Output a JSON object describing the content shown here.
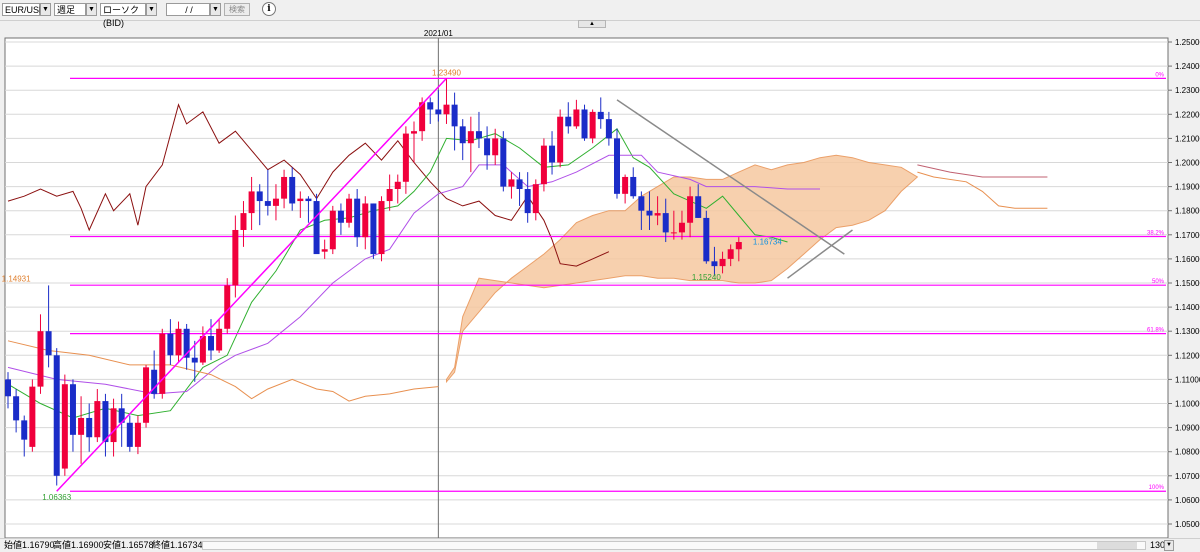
{
  "toolbar": {
    "symbol": "EUR/USD",
    "period": "週足",
    "chart_type": "ローソク(BID)",
    "date_value": " /  / ",
    "search_label": "検索",
    "info_label": "i",
    "arrow": "▼"
  },
  "status": {
    "open": "始値1.16790",
    "high": "高値1.16900",
    "low": "安値1.16578",
    "close": "終値1.16734",
    "zoom": "130"
  },
  "colors": {
    "up": "#f0003c",
    "down": "#1a2cc8",
    "magenta": "#ff00ff",
    "cloud": "#f6c8a0",
    "lagging": "#8b1010",
    "tenkan": "#30b030",
    "kijun": "#b050e8",
    "trend": "#8a8a8a"
  },
  "chart_data": {
    "type": "candlestick",
    "xlabel": "",
    "ylabel": "",
    "ylim": [
      1.05,
      1.25
    ],
    "y_ticks": [
      "1.25000",
      "1.24000",
      "1.23000",
      "1.22000",
      "1.21000",
      "1.20000",
      "1.19000",
      "1.18000",
      "1.17000",
      "1.16000",
      "1.15000",
      "1.14000",
      "1.13000",
      "1.12000",
      "1.11000",
      "1.10000",
      "1.09000",
      "1.08000",
      "1.07000",
      "1.06000",
      "1.05000"
    ],
    "x_label": "2021/01",
    "x_label_index": 53,
    "candles": [
      [
        1.11,
        1.113,
        1.098,
        1.103
      ],
      [
        1.103,
        1.106,
        1.088,
        1.093
      ],
      [
        1.093,
        1.095,
        1.078,
        1.085
      ],
      [
        1.082,
        1.11,
        1.08,
        1.107
      ],
      [
        1.107,
        1.137,
        1.104,
        1.13
      ],
      [
        1.13,
        1.149,
        1.115,
        1.12
      ],
      [
        1.12,
        1.123,
        1.066,
        1.07
      ],
      [
        1.073,
        1.112,
        1.07,
        1.108
      ],
      [
        1.108,
        1.11,
        1.08,
        1.087
      ],
      [
        1.087,
        1.103,
        1.075,
        1.094
      ],
      [
        1.094,
        1.1,
        1.08,
        1.086
      ],
      [
        1.086,
        1.106,
        1.084,
        1.101
      ],
      [
        1.101,
        1.104,
        1.078,
        1.084
      ],
      [
        1.084,
        1.102,
        1.078,
        1.098
      ],
      [
        1.098,
        1.104,
        1.082,
        1.092
      ],
      [
        1.092,
        1.095,
        1.08,
        1.082
      ],
      [
        1.082,
        1.095,
        1.079,
        1.092
      ],
      [
        1.092,
        1.116,
        1.09,
        1.115
      ],
      [
        1.114,
        1.122,
        1.102,
        1.104
      ],
      [
        1.104,
        1.131,
        1.102,
        1.129
      ],
      [
        1.129,
        1.135,
        1.116,
        1.12
      ],
      [
        1.12,
        1.134,
        1.117,
        1.131
      ],
      [
        1.131,
        1.133,
        1.114,
        1.119
      ],
      [
        1.119,
        1.126,
        1.109,
        1.117
      ],
      [
        1.117,
        1.132,
        1.116,
        1.128
      ],
      [
        1.128,
        1.135,
        1.118,
        1.122
      ],
      [
        1.122,
        1.135,
        1.121,
        1.131
      ],
      [
        1.131,
        1.152,
        1.129,
        1.149
      ],
      [
        1.149,
        1.178,
        1.144,
        1.172
      ],
      [
        1.172,
        1.184,
        1.165,
        1.179
      ],
      [
        1.179,
        1.194,
        1.172,
        1.188
      ],
      [
        1.188,
        1.191,
        1.174,
        1.184
      ],
      [
        1.184,
        1.197,
        1.178,
        1.182
      ],
      [
        1.182,
        1.191,
        1.176,
        1.185
      ],
      [
        1.185,
        1.197,
        1.181,
        1.194
      ],
      [
        1.194,
        1.198,
        1.18,
        1.183
      ],
      [
        1.184,
        1.188,
        1.177,
        1.185
      ],
      [
        1.185,
        1.186,
        1.175,
        1.184
      ],
      [
        1.184,
        1.187,
        1.17,
        1.162
      ],
      [
        1.163,
        1.168,
        1.16,
        1.164
      ],
      [
        1.164,
        1.182,
        1.162,
        1.18
      ],
      [
        1.18,
        1.183,
        1.17,
        1.175
      ],
      [
        1.175,
        1.187,
        1.173,
        1.185
      ],
      [
        1.185,
        1.189,
        1.165,
        1.169
      ],
      [
        1.169,
        1.186,
        1.164,
        1.183
      ],
      [
        1.183,
        1.183,
        1.16,
        1.162
      ],
      [
        1.162,
        1.186,
        1.159,
        1.184
      ],
      [
        1.184,
        1.195,
        1.18,
        1.189
      ],
      [
        1.189,
        1.195,
        1.183,
        1.192
      ],
      [
        1.192,
        1.215,
        1.187,
        1.212
      ],
      [
        1.212,
        1.217,
        1.2,
        1.213
      ],
      [
        1.213,
        1.227,
        1.209,
        1.225
      ],
      [
        1.225,
        1.227,
        1.216,
        1.222
      ],
      [
        1.222,
        1.23,
        1.217,
        1.22
      ],
      [
        1.22,
        1.235,
        1.216,
        1.224
      ],
      [
        1.224,
        1.229,
        1.205,
        1.215
      ],
      [
        1.215,
        1.218,
        1.201,
        1.208
      ],
      [
        1.208,
        1.219,
        1.196,
        1.213
      ],
      [
        1.213,
        1.221,
        1.206,
        1.21
      ],
      [
        1.21,
        1.215,
        1.197,
        1.203
      ],
      [
        1.203,
        1.214,
        1.199,
        1.21
      ],
      [
        1.21,
        1.213,
        1.188,
        1.19
      ],
      [
        1.19,
        1.196,
        1.185,
        1.193
      ],
      [
        1.193,
        1.196,
        1.182,
        1.189
      ],
      [
        1.189,
        1.196,
        1.175,
        1.179
      ],
      [
        1.179,
        1.193,
        1.176,
        1.191
      ],
      [
        1.191,
        1.21,
        1.188,
        1.207
      ],
      [
        1.207,
        1.213,
        1.195,
        1.2
      ],
      [
        1.2,
        1.222,
        1.198,
        1.219
      ],
      [
        1.219,
        1.225,
        1.212,
        1.215
      ],
      [
        1.215,
        1.226,
        1.214,
        1.222
      ],
      [
        1.222,
        1.224,
        1.209,
        1.21
      ],
      [
        1.21,
        1.222,
        1.208,
        1.221
      ],
      [
        1.221,
        1.227,
        1.214,
        1.218
      ],
      [
        1.218,
        1.221,
        1.207,
        1.21
      ],
      [
        1.21,
        1.214,
        1.185,
        1.187
      ],
      [
        1.187,
        1.195,
        1.183,
        1.194
      ],
      [
        1.194,
        1.198,
        1.185,
        1.186
      ],
      [
        1.186,
        1.188,
        1.172,
        1.18
      ],
      [
        1.18,
        1.188,
        1.172,
        1.178
      ],
      [
        1.178,
        1.186,
        1.174,
        1.179
      ],
      [
        1.179,
        1.185,
        1.167,
        1.171
      ],
      [
        1.171,
        1.18,
        1.168,
        1.171
      ],
      [
        1.171,
        1.18,
        1.168,
        1.175
      ],
      [
        1.175,
        1.19,
        1.169,
        1.186
      ],
      [
        1.186,
        1.191,
        1.177,
        1.177
      ],
      [
        1.177,
        1.18,
        1.158,
        1.159
      ],
      [
        1.159,
        1.165,
        1.153,
        1.157
      ],
      [
        1.157,
        1.163,
        1.154,
        1.16
      ],
      [
        1.16,
        1.166,
        1.157,
        1.164
      ],
      [
        1.164,
        1.169,
        1.159,
        1.167
      ]
    ],
    "horizontal_lines": [
      {
        "value": 1.2349,
        "label": "0%"
      },
      {
        "value": 1.1693,
        "label": "38.2%"
      },
      {
        "value": 1.1491,
        "label": "50%"
      },
      {
        "value": 1.129,
        "label": "61.8%"
      },
      {
        "value": 1.0636,
        "label": "100%"
      }
    ],
    "annotations": [
      {
        "text": "1.23490",
        "value": 1.2349,
        "index": 54
      },
      {
        "text": "1.14931",
        "value": 1.1493,
        "index": 1
      },
      {
        "text": "1.06363",
        "value": 1.0636,
        "index": 6
      },
      {
        "text": "1.15240",
        "value": 1.1524,
        "index": 86
      },
      {
        "text": "1.16734",
        "value": 1.1673,
        "index": 91
      }
    ]
  }
}
